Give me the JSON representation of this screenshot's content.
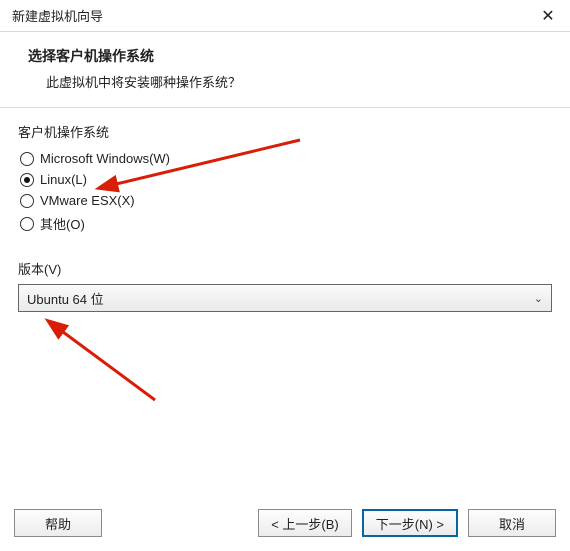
{
  "window": {
    "title": "新建虚拟机向导"
  },
  "header": {
    "title": "选择客户机操作系统",
    "subtitle": "此虚拟机中将安装哪种操作系统？"
  },
  "os_group": {
    "label": "客户机操作系统",
    "selected": "linux",
    "options": {
      "windows": "Microsoft Windows(W)",
      "linux": "Linux(L)",
      "vmware_esx": "VMware ESX(X)",
      "other": "其他(O)"
    }
  },
  "version": {
    "label": "版本(V)",
    "selected": "Ubuntu 64 位"
  },
  "buttons": {
    "help": "帮助",
    "back": "< 上一步(B)",
    "next": "下一步(N) >",
    "cancel": "取消"
  },
  "annotation": {
    "color": "#d81e06"
  }
}
